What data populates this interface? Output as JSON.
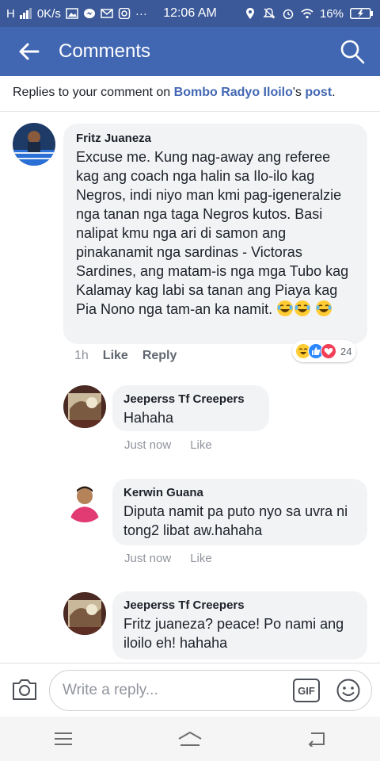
{
  "status_bar": {
    "network": "H",
    "speed": "0K/s",
    "time": "12:06 AM",
    "battery": "16%"
  },
  "header": {
    "title": "Comments",
    "background": "#4267b2"
  },
  "notice": {
    "prefix": "Replies to your comment on ",
    "page_name": "Bombo Radyo Iloilo",
    "possessive": "'s ",
    "post_link": "post",
    "suffix": "."
  },
  "main_comment": {
    "author": "Fritz Juaneza",
    "text": "Excuse me. Kung nag-away ang referee kag ang coach nga halin sa Ilo-ilo kag Negros, indi niyo man kmi pag-igeneralzie nga tanan nga taga Negros kutos. Basi nalipat kmu nga ari di samon ang pinakanamit nga sardinas - Victoras Sardines, ang matam-is nga mga Tubo kag Kalamay kag labi sa tanan ang Piaya kag Pia Nono nga tam-an ka namit.",
    "time": "1h",
    "like_label": "Like",
    "reply_label": "Reply",
    "reaction_count": "24",
    "reaction_icons": [
      "haha-icon",
      "like-icon",
      "love-icon"
    ]
  },
  "replies": [
    {
      "author": "Jeeperss Tf Creepers",
      "text": "Hahaha",
      "time": "Just now",
      "like_label": "Like"
    },
    {
      "author": "Kerwin Guana",
      "text": "Diputa namit pa puto nyo sa uvra ni tong2 libat aw.hahaha",
      "time": "Just now",
      "like_label": "Like"
    },
    {
      "author": "Jeeperss Tf Creepers",
      "text": "Fritz juaneza? peace! Po nami ang iloilo eh! hahaha"
    }
  ],
  "composer": {
    "placeholder": "Write a reply...",
    "gif_label": "GIF"
  },
  "colors": {
    "brand_blue": "#4267b2",
    "status_blue": "#3b5998",
    "bubble_grey": "#f2f3f5",
    "meta_grey": "#90949c"
  }
}
